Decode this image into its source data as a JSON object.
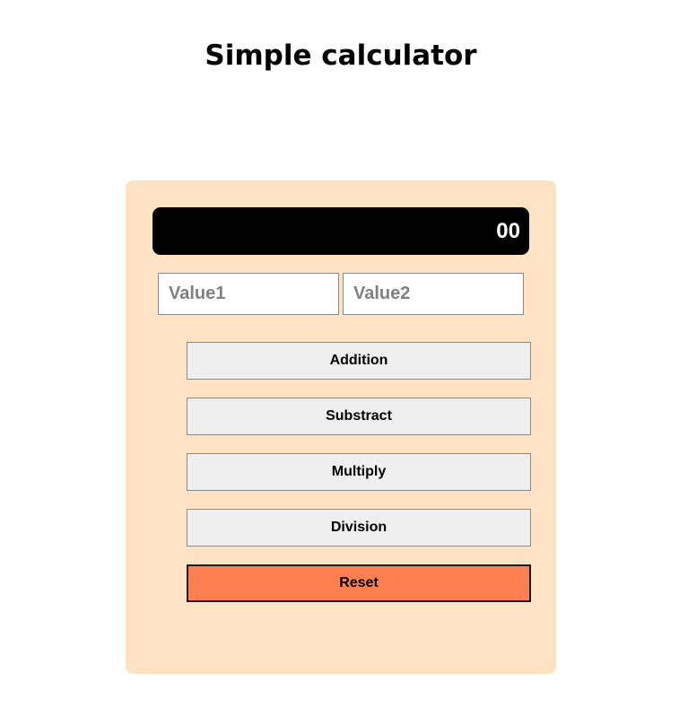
{
  "page": {
    "title": "Simple calculator"
  },
  "calculator": {
    "display_value": "00",
    "inputs": {
      "value1": {
        "value": "",
        "placeholder": "Value1"
      },
      "value2": {
        "value": "",
        "placeholder": "Value2"
      }
    },
    "buttons": {
      "addition": "Addition",
      "subtract": "Substract",
      "multiply": "Multiply",
      "division": "Division",
      "reset": "Reset"
    }
  },
  "colors": {
    "panel_background": "#fde3c3",
    "display_background": "#000000",
    "display_text": "#ffffff",
    "button_background": "#efefef",
    "reset_background": "#ff7f50"
  }
}
